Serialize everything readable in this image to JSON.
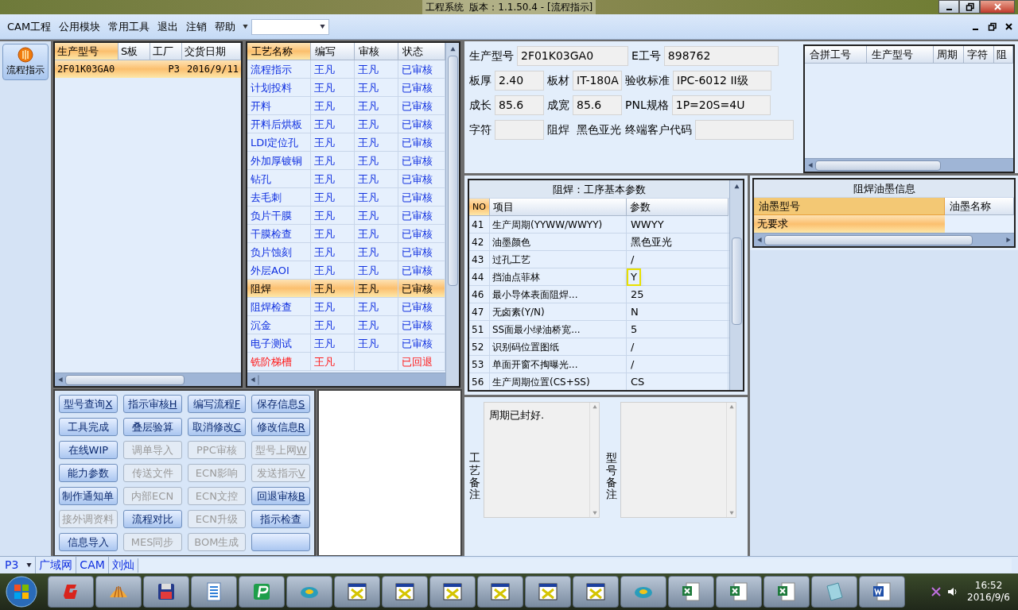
{
  "window": {
    "title": "工程系统  版本：1.1.50.4 - [流程指示]"
  },
  "menu": [
    "CAM工程",
    "公用模块",
    "常用工具",
    "退出",
    "注销",
    "帮助"
  ],
  "nav": {
    "label": "流程指示",
    "selected": true
  },
  "orders": {
    "columns": [
      "生产型号",
      "S板",
      "工厂",
      "交货日期"
    ],
    "rows": [
      {
        "cells": [
          "2F01K03GA0",
          "",
          "P3",
          "2016/9/11"
        ],
        "selected": true
      }
    ]
  },
  "process": {
    "columns": [
      "工艺名称",
      "编写",
      "审核",
      "状态"
    ],
    "rows": [
      {
        "cells": [
          "流程指示",
          "王凡",
          "王凡",
          "已审核"
        ],
        "selected": false,
        "rejected": false
      },
      {
        "cells": [
          "计划投料",
          "王凡",
          "王凡",
          "已审核"
        ],
        "selected": false,
        "rejected": false
      },
      {
        "cells": [
          "开料",
          "王凡",
          "王凡",
          "已审核"
        ],
        "selected": false,
        "rejected": false
      },
      {
        "cells": [
          "开料后烘板",
          "王凡",
          "王凡",
          "已审核"
        ],
        "selected": false,
        "rejected": false
      },
      {
        "cells": [
          "LDI定位孔",
          "王凡",
          "王凡",
          "已审核"
        ],
        "selected": false,
        "rejected": false
      },
      {
        "cells": [
          "外加厚镀铜",
          "王凡",
          "王凡",
          "已审核"
        ],
        "selected": false,
        "rejected": false
      },
      {
        "cells": [
          "钻孔",
          "王凡",
          "王凡",
          "已审核"
        ],
        "selected": false,
        "rejected": false
      },
      {
        "cells": [
          "去毛刺",
          "王凡",
          "王凡",
          "已审核"
        ],
        "selected": false,
        "rejected": false
      },
      {
        "cells": [
          "负片干膜",
          "王凡",
          "王凡",
          "已审核"
        ],
        "selected": false,
        "rejected": false
      },
      {
        "cells": [
          "干膜检查",
          "王凡",
          "王凡",
          "已审核"
        ],
        "selected": false,
        "rejected": false
      },
      {
        "cells": [
          "负片蚀刻",
          "王凡",
          "王凡",
          "已审核"
        ],
        "selected": false,
        "rejected": false
      },
      {
        "cells": [
          "外层AOI",
          "王凡",
          "王凡",
          "已审核"
        ],
        "selected": false,
        "rejected": false
      },
      {
        "cells": [
          "阻焊",
          "王凡",
          "王凡",
          "已审核"
        ],
        "selected": true,
        "rejected": false
      },
      {
        "cells": [
          "阻焊检查",
          "王凡",
          "王凡",
          "已审核"
        ],
        "selected": false,
        "rejected": false
      },
      {
        "cells": [
          "沉金",
          "王凡",
          "王凡",
          "已审核"
        ],
        "selected": false,
        "rejected": false
      },
      {
        "cells": [
          "电子测试",
          "王凡",
          "王凡",
          "已审核"
        ],
        "selected": false,
        "rejected": false
      },
      {
        "cells": [
          "铣阶梯槽",
          "王凡",
          "",
          "已回退"
        ],
        "selected": false,
        "rejected": true
      }
    ]
  },
  "buttons": [
    {
      "label": "型号查询",
      "hotkey": "X",
      "disabled": false
    },
    {
      "label": "指示审核",
      "hotkey": "H",
      "disabled": false
    },
    {
      "label": "编写流程",
      "hotkey": "F",
      "disabled": false
    },
    {
      "label": "保存信息",
      "hotkey": "S",
      "disabled": false
    },
    {
      "label": "工具完成",
      "disabled": false
    },
    {
      "label": "叠层验算",
      "disabled": false
    },
    {
      "label": "取消修改",
      "hotkey": "C",
      "disabled": false
    },
    {
      "label": "修改信息",
      "hotkey": "R",
      "disabled": false
    },
    {
      "label": "在线WIP",
      "disabled": false
    },
    {
      "label": "调单导入",
      "disabled": true
    },
    {
      "label": "PPC审核",
      "disabled": true
    },
    {
      "label": "型号上网",
      "hotkey": "W",
      "disabled": true
    },
    {
      "label": "能力参数",
      "disabled": false
    },
    {
      "label": "传送文件",
      "disabled": true
    },
    {
      "label": "ECN影响",
      "disabled": true
    },
    {
      "label": "发送指示",
      "hotkey": "V",
      "disabled": true
    },
    {
      "label": "制作通知单",
      "disabled": false
    },
    {
      "label": "内部ECN",
      "disabled": true
    },
    {
      "label": "ECN文控",
      "disabled": true
    },
    {
      "label": "回退审核",
      "hotkey": "B",
      "disabled": false
    },
    {
      "label": "接外调资料",
      "disabled": true
    },
    {
      "label": "流程对比",
      "disabled": false
    },
    {
      "label": "ECN升级",
      "disabled": true
    },
    {
      "label": "指示检查",
      "disabled": false
    },
    {
      "label": "信息导入",
      "disabled": false
    },
    {
      "label": "MES同步",
      "disabled": true
    },
    {
      "label": "BOM生成",
      "disabled": true
    },
    {
      "disabled": false
    }
  ],
  "fields": [
    [
      {
        "label": "生产型号",
        "value": "2F01K03GA0"
      },
      {
        "label": "E工号",
        "value": "898762"
      }
    ],
    [
      {
        "label": "板厚",
        "value": "2.40"
      },
      {
        "label": "板材",
        "value": "IT-180A"
      },
      {
        "label": "验收标准",
        "value": "IPC-6012 II级"
      }
    ],
    [
      {
        "label": "成长",
        "value": "85.6"
      },
      {
        "label": "成宽",
        "value": "85.6"
      },
      {
        "label": "PNL规格",
        "value": "1P=20S=4U"
      }
    ],
    [
      {
        "label": "字符"
      },
      {
        "label": "阻焊",
        "value": "黑色亚光"
      },
      {
        "label": "终端客户代码"
      }
    ]
  ],
  "params": {
    "title": "阻焊：工序基本参数",
    "columns": [
      "NO",
      "项目",
      "参数"
    ],
    "rows": [
      {
        "cells": [
          "41",
          "生产周期(YYWW/WWYY)",
          "WWYY"
        ],
        "focused": false
      },
      {
        "cells": [
          "42",
          "油墨颜色",
          "黑色亚光"
        ],
        "focused": false
      },
      {
        "cells": [
          "43",
          "过孔工艺",
          "/"
        ],
        "focused": false
      },
      {
        "cells": [
          "44",
          "挡油点菲林",
          "Y"
        ],
        "focused": true
      },
      {
        "cells": [
          "46",
          "最小导体表面阻焊...",
          "25"
        ],
        "focused": false
      },
      {
        "cells": [
          "47",
          "无卤素(Y/N)",
          "N"
        ],
        "focused": false
      },
      {
        "cells": [
          "51",
          "SS面最小绿油桥宽...",
          "5"
        ],
        "focused": false
      },
      {
        "cells": [
          "52",
          "识别码位置图纸",
          "/"
        ],
        "focused": false
      },
      {
        "cells": [
          "53",
          "单面开窗不掏曝光...",
          "/"
        ],
        "focused": false
      },
      {
        "cells": [
          "56",
          "生产周期位置(CS+SS)",
          "CS"
        ],
        "focused": false
      }
    ]
  },
  "remarks": [
    {
      "label": "工艺备注",
      "text": "周期已封好."
    },
    {
      "label": "型号备注"
    }
  ],
  "merge": {
    "columns": [
      "合拼工号",
      "生产型号",
      "周期",
      "字符",
      "阻"
    ]
  },
  "ink": {
    "title": "阻焊油墨信息",
    "columns": [
      "油墨型号",
      "油墨名称"
    ],
    "rows": [
      {
        "cells": [
          "无要求",
          ""
        ],
        "selected": true
      }
    ]
  },
  "status_bar": {
    "factory": "P3",
    "items": [
      "广域网",
      "CAM",
      "刘灿"
    ]
  },
  "clock": {
    "time": "16:52",
    "date": "2016/9/6"
  }
}
